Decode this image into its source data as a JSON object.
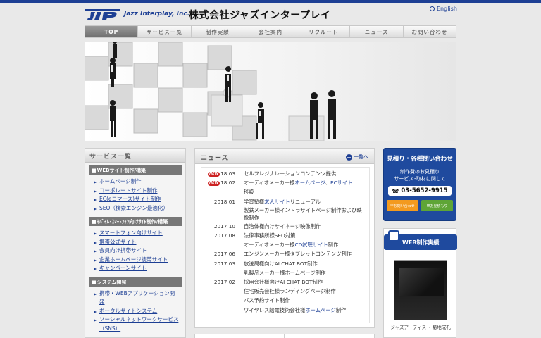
{
  "header": {
    "logo_text": "Jazz Interplay, Inc.",
    "company_name": "株式会社ジャズインタープレイ",
    "lang_link": "English"
  },
  "nav": {
    "items": [
      "TOP",
      "サービス一覧",
      "制作実績",
      "会社案内",
      "リクルート",
      "ニュース",
      "お問い合わせ"
    ],
    "active_index": 0
  },
  "sidebar": {
    "title": "サービス一覧",
    "categories": [
      {
        "label": "WEBサイト制作/構築",
        "items": [
          "ホームページ制作",
          "コーポレートサイト制作",
          "EC(eコマース)サイト制作",
          "SEO（検索エンジン最適化）"
        ]
      },
      {
        "label": "ﾓﾊﾞｲﾙ･ｽﾏｰﾄﾌｫﾝ向けｻｲﾄ制作/構築",
        "items": [
          "スマートフォン向けサイト",
          "携帯公式サイト",
          "会員向け携帯サイト",
          "企業ホームページ携帯サイト",
          "キャンペーンサイト"
        ]
      },
      {
        "label": "システム開発",
        "items": [
          "携帯・WEBアプリケーション開発",
          "ポータルサイトシステム",
          "ソーシャルネットワークサービス（SNS）"
        ]
      }
    ]
  },
  "news": {
    "title": "ニュース",
    "more": "一覧へ",
    "badge": "NEW",
    "rows": [
      {
        "date": "18.03",
        "new": true,
        "text": "セルフレジナレーションコンテンツ提供"
      },
      {
        "date": "18.02",
        "new": true,
        "text_pre": "オーディオメーカー様",
        "hl1": "ホームページ",
        "mid": "、",
        "hl2": "ECサイト",
        "text_post": "移設"
      },
      {
        "date": "2018.01",
        "new": false,
        "text_pre": "学習塾様",
        "hl1": "求人サイト",
        "text_post": "リニューアル"
      },
      {
        "date": "",
        "new": false,
        "text": "製鉄メーカー様イントラサイトページ制作および映像制作"
      },
      {
        "date": "2017.10",
        "new": false,
        "text": "自治体様向けサイネージ映像制作"
      },
      {
        "date": "2017.08",
        "new": false,
        "text": "法律事務所様SEO対策"
      },
      {
        "date": "",
        "new": false,
        "text_pre": "オーディオメーカー様",
        "hl1": "CD試聴サイト",
        "text_post": "制作"
      },
      {
        "date": "2017.06",
        "new": false,
        "text": "エンジンメーカー様タブレットコンテンツ制作"
      },
      {
        "date": "2017.03",
        "new": false,
        "text": "放送局様向けAI CHAT BOT制作"
      },
      {
        "date": "",
        "new": false,
        "text": "乳製品メーカー様ホームページ制作"
      },
      {
        "date": "2017.02",
        "new": false,
        "text": "採用会社様向けAI CHAT BOT制作"
      },
      {
        "date": "",
        "new": false,
        "text": "住宅販売会社様ランディングページ制作"
      },
      {
        "date": "",
        "new": false,
        "text": "バス予約サイト制作"
      },
      {
        "date": "",
        "new": false,
        "text_pre": "ワイヤレス給電技術会社様",
        "hl1": "ホームページ",
        "text_post": "制作"
      }
    ]
  },
  "contact": {
    "title": "見積り・各種問い合わせ",
    "sub1": "制作費のお見積り",
    "sub2": "サービス･取材に関して",
    "phone": "03-5652-9915",
    "mail_label": "お問い合わせ",
    "form_label": "お見積もり"
  },
  "works": {
    "title": "WEB制作実績",
    "caption": "ジャズアーティスト 菊地成孔"
  },
  "colors": {
    "brand_blue": "#1d3f94",
    "nav_active": "#7a7a7a",
    "new_badge": "#cc2222"
  }
}
